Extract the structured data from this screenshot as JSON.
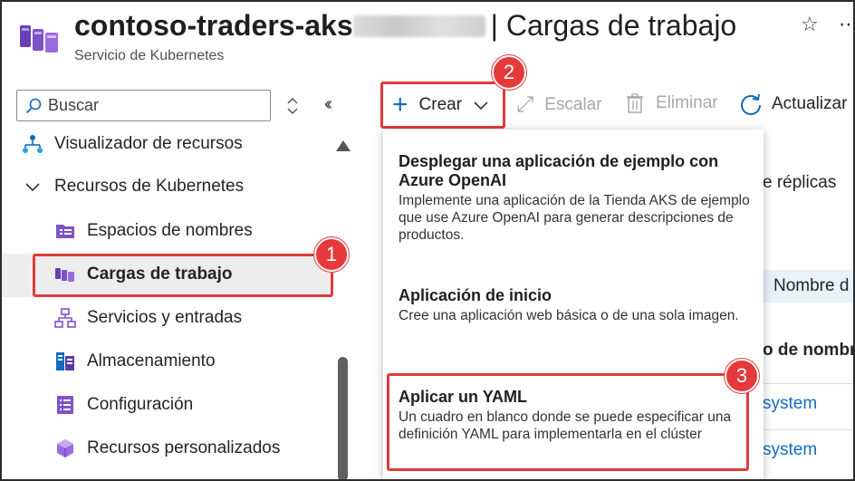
{
  "header": {
    "title_main": "contoso-traders-aks",
    "title_separator": "|",
    "title_page": "Cargas de trabajo",
    "subtitle": "Servicio de Kubernetes"
  },
  "sidebar": {
    "search_placeholder": "Buscar",
    "items": [
      {
        "label": "Visualizador de recursos",
        "icon": "resource-visualizer-icon"
      },
      {
        "label": "Recursos de Kubernetes",
        "icon": "chevron-down-icon",
        "expanded": true
      },
      {
        "label": "Espacios de nombres",
        "icon": "namespaces-icon"
      },
      {
        "label": "Cargas de trabajo",
        "icon": "workloads-icon",
        "selected": true
      },
      {
        "label": "Servicios y entradas",
        "icon": "services-icon"
      },
      {
        "label": "Almacenamiento",
        "icon": "storage-icon"
      },
      {
        "label": "Configuración",
        "icon": "configuration-icon"
      },
      {
        "label": "Recursos personalizados",
        "icon": "custom-resources-icon"
      }
    ]
  },
  "toolbar": {
    "create_label": "Crear",
    "scale_label": "Escalar",
    "delete_label": "Eliminar",
    "refresh_label": "Actualizar"
  },
  "background": {
    "replicas_text": "e réplicas",
    "name_column": "Nombre d",
    "name_header": "o de nombr",
    "row1": "system",
    "row2": "system"
  },
  "menu": {
    "items": [
      {
        "title": "Desplegar una aplicación de ejemplo con Azure OpenAI",
        "description": "Implemente una aplicación de la Tienda AKS de ejemplo que use Azure OpenAI para generar descripciones de productos."
      },
      {
        "title": "Aplicación de inicio",
        "description": "Cree una aplicación web básica o de una sola imagen."
      },
      {
        "title": "Aplicar un YAML",
        "description": "Un cuadro en blanco donde se puede especificar una definición YAML para implementarla en el clúster"
      }
    ]
  },
  "callouts": [
    "1",
    "2",
    "3"
  ],
  "colors": {
    "accent": "#0f6cbd",
    "annotation": "#e5393b"
  }
}
